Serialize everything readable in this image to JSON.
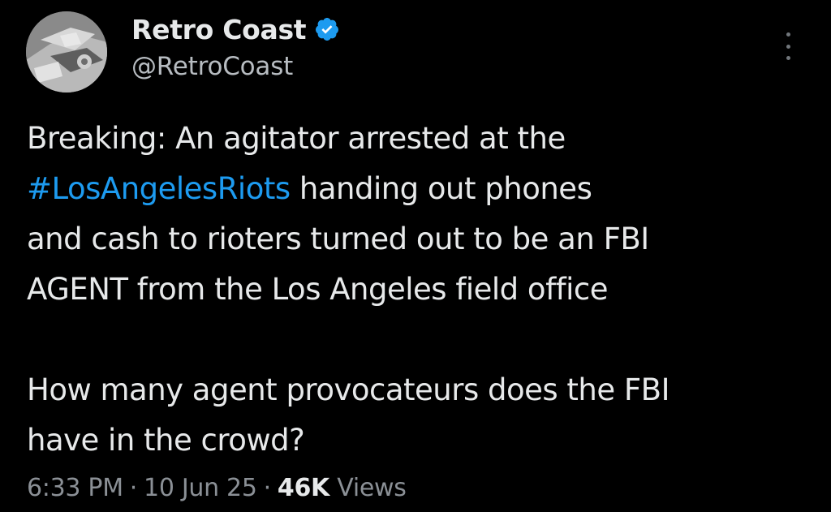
{
  "tweet": {
    "author": {
      "display_name": "Retro Coast",
      "handle": "@RetroCoast",
      "verified_icon": "verified-badge-icon",
      "avatar_icon": "car-photo-avatar"
    },
    "more_icon": "more-options-icon",
    "text": {
      "line1": "Breaking: An agitator arrested at the",
      "hashtag": "#LosAngelesRiots",
      "line2_rest": " handing out phones",
      "line3": "and cash to rioters turned out to be an FBI",
      "line4": "AGENT from the Los Angeles field office",
      "line5": "How many agent provocateurs does the FBI",
      "line6": "have in the crowd?"
    },
    "meta": {
      "time": "6:33 PM",
      "separator": "·",
      "date": "10 Jun 25",
      "views_count": "46K",
      "views_label": "Views"
    }
  },
  "colors": {
    "background": "#000000",
    "text": "#e7e9ea",
    "secondary": "#8b9096",
    "link": "#1d9bf0",
    "verified": "#1d9bf0"
  }
}
